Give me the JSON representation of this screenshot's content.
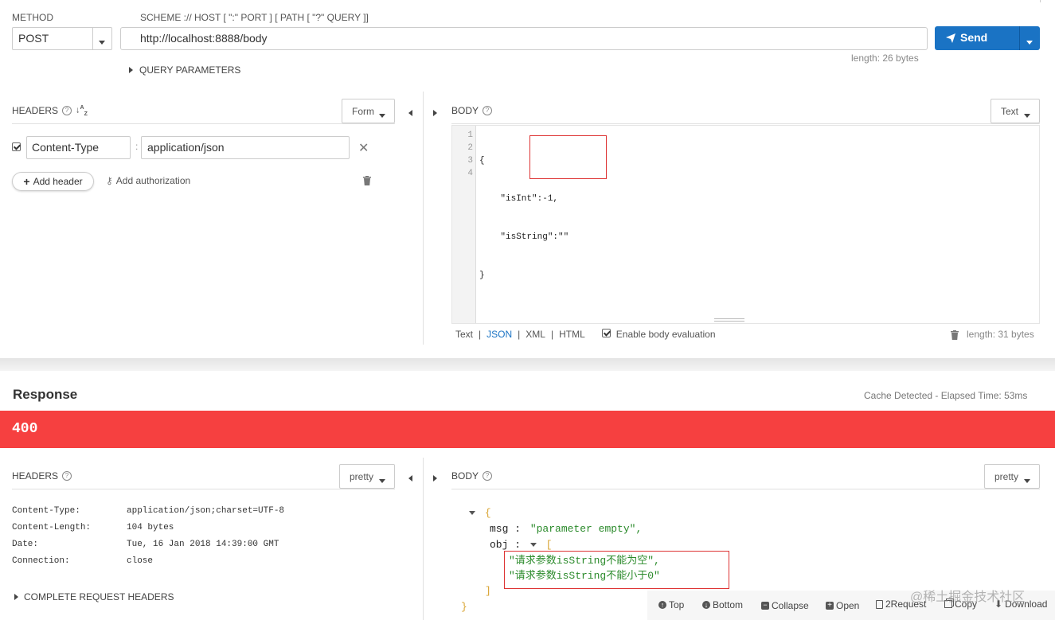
{
  "request": {
    "method_label": "METHOD",
    "method_value": "POST",
    "url_label": "SCHEME :// HOST [ \":\" PORT ] [ PATH [ \"?\" QUERY ]]",
    "url_value": "http://localhost:8888/body",
    "url_length": "length: 26 bytes",
    "send_label": "Send",
    "query_params_label": "QUERY PARAMETERS"
  },
  "req_headers": {
    "title": "HEADERS",
    "mode": "Form",
    "rows": [
      {
        "name": "Content-Type",
        "value": "application/json"
      }
    ],
    "add_header": "Add header",
    "add_authorization": "Add authorization"
  },
  "req_body": {
    "title": "BODY",
    "mode": "Text",
    "lines": [
      {
        "n": "1",
        "code": "{"
      },
      {
        "n": "2",
        "code": "    \"isInt\":-1,"
      },
      {
        "n": "3",
        "code": "    \"isString\":\"\""
      },
      {
        "n": "4",
        "code": "}"
      }
    ],
    "formats": [
      "Text",
      "JSON",
      "XML",
      "HTML"
    ],
    "separator": "|",
    "active_format": "JSON",
    "enable_eval": "Enable body evaluation",
    "length": "length: 31 bytes"
  },
  "response": {
    "title": "Response",
    "meta": "Cache Detected - Elapsed Time: 53ms",
    "status": "400",
    "status_color": "#f64040"
  },
  "resp_headers": {
    "title": "HEADERS",
    "mode": "pretty",
    "rows": [
      {
        "name": "Content-Type:",
        "value": "application/json;charset=UTF-8"
      },
      {
        "name": "Content-Length:",
        "value": "104 bytes"
      },
      {
        "name": "Date:",
        "value": "Tue, 16 Jan 2018 14:39:00 GMT"
      },
      {
        "name": "Connection:",
        "value": "close"
      }
    ],
    "complete_label": "COMPLETE REQUEST HEADERS"
  },
  "resp_body": {
    "title": "BODY",
    "mode": "pretty",
    "open_brace": "{",
    "msg_key": "msg :",
    "msg_value": "\"parameter empty\",",
    "obj_key": "obj :",
    "open_bracket": "[",
    "items": [
      "\"请求参数isString不能为空\",",
      "\"请求参数isString不能小于0\""
    ],
    "close_bracket": "]",
    "close_brace": "}"
  },
  "toolbar": {
    "top": "Top",
    "bottom": "Bottom",
    "collapse": "Collapse",
    "open": "Open",
    "to_request": "2Request",
    "copy": "Copy",
    "download": "Download"
  },
  "watermark": "@稀土掘金技术社区",
  "colors": {
    "accent_blue": "#1a73c4",
    "json_key": "#222222",
    "json_string": "#2a8a2a",
    "brace_orange": "#d9a534",
    "highlight_box": "#d33"
  }
}
